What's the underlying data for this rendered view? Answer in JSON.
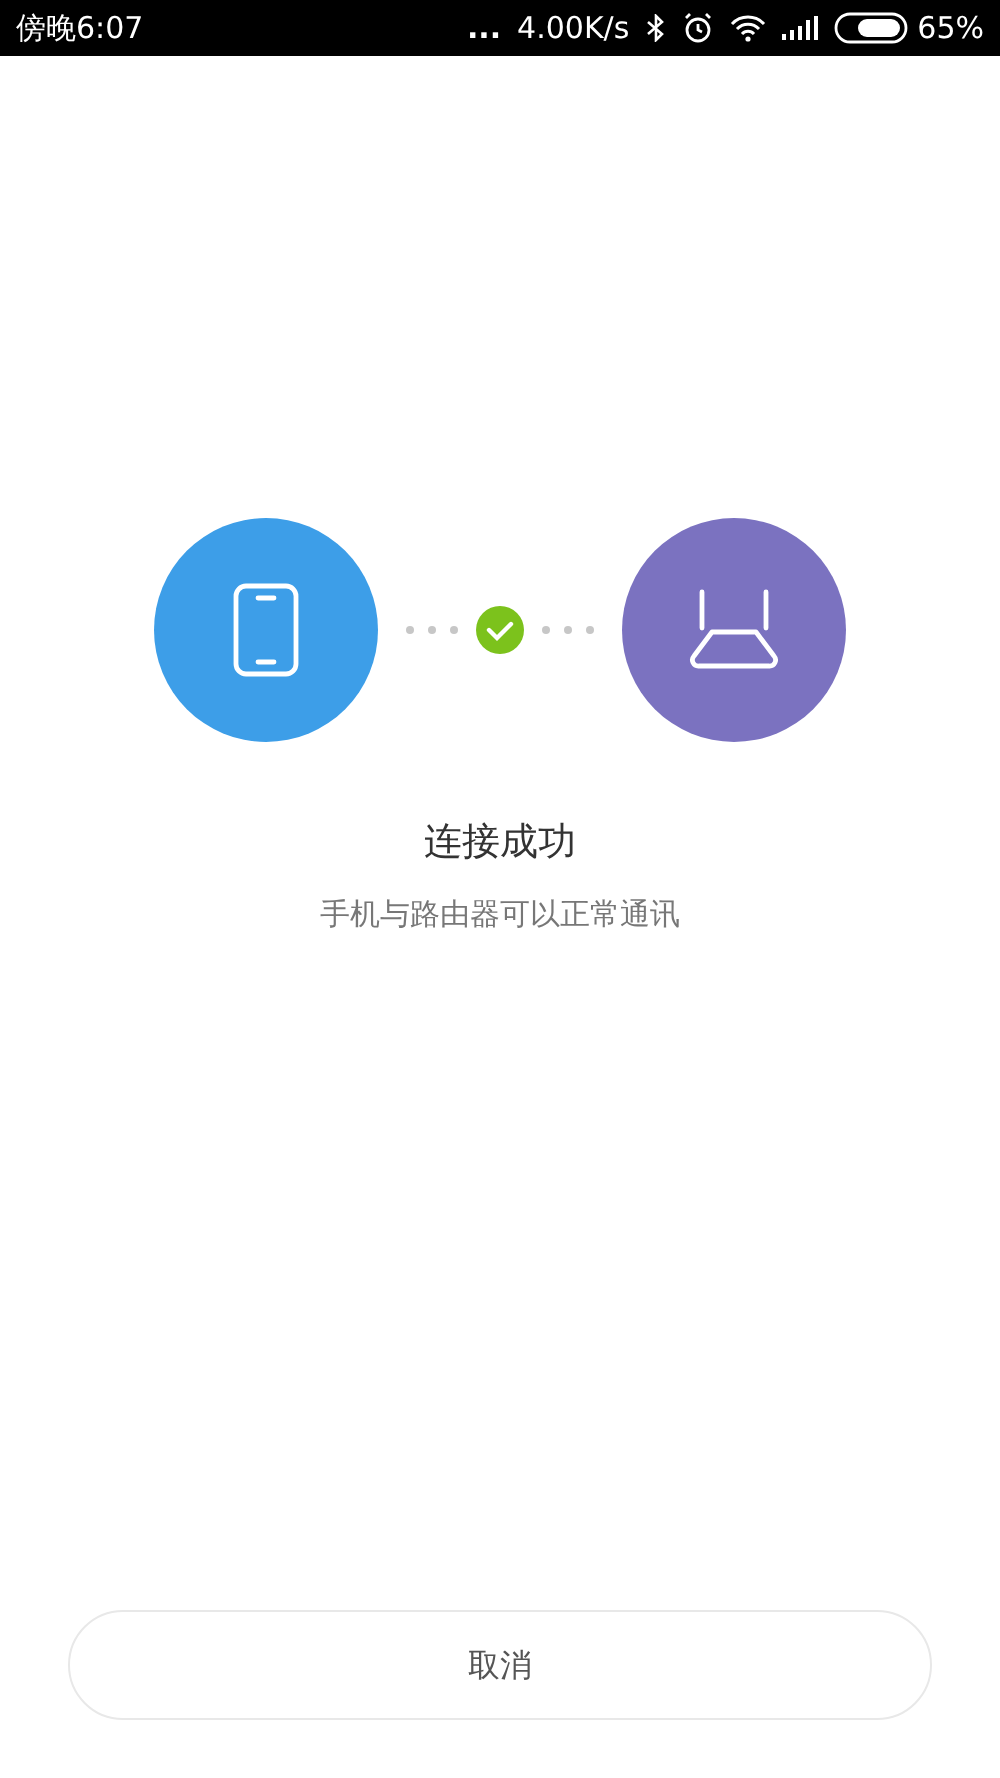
{
  "status_bar": {
    "time": "傍晚6:07",
    "more": "...",
    "speed": "4.00K/s",
    "battery": "65%"
  },
  "connection": {
    "connected": true
  },
  "title": "连接成功",
  "subtitle": "手机与路由器可以正常通讯",
  "cancel_button": "取消"
}
